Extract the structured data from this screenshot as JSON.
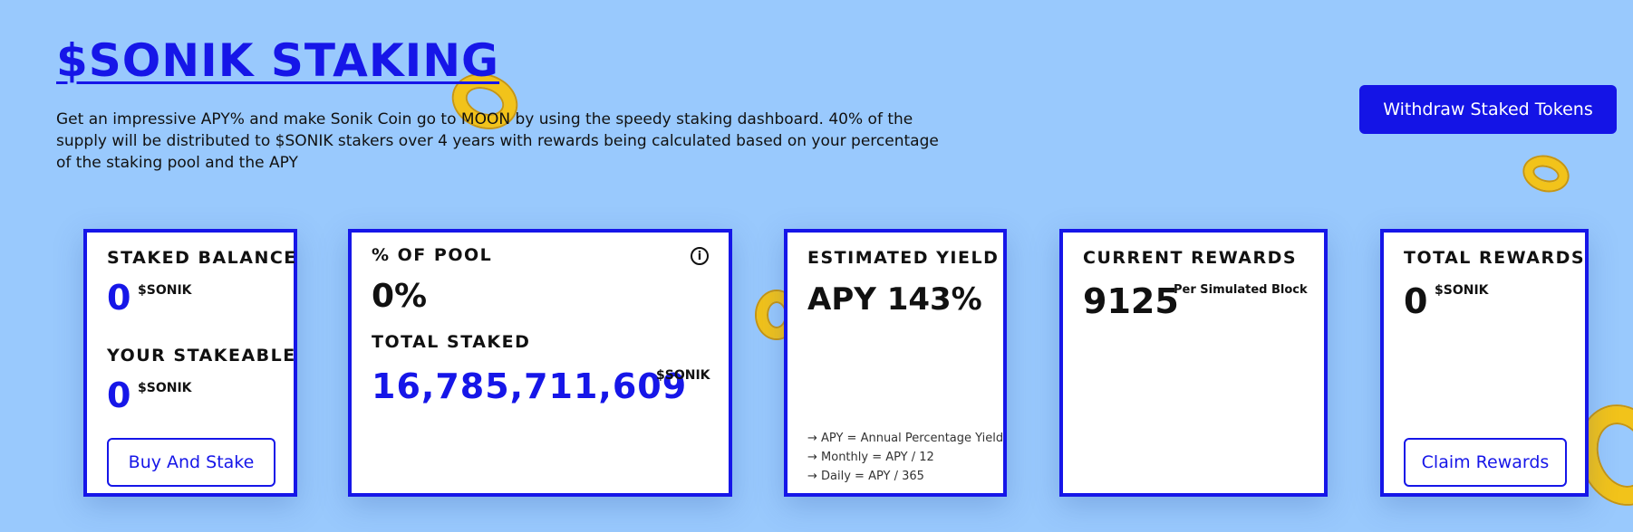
{
  "header": {
    "title": "$SONIK STAKING",
    "description": "Get an impressive APY% and make Sonik Coin go to MOON by using the speedy staking dashboard. 40% of the supply will be distributed to $SONIK stakers over 4 years with rewards being calculated based on your percentage of the staking pool and the APY",
    "withdraw_label": "Withdraw Staked Tokens"
  },
  "cards": {
    "balance": {
      "staked_label": "STAKED BALANCE",
      "staked_value": "0",
      "staked_unit": "$SONIK",
      "stakeable_label": "YOUR STAKEABLE",
      "stakeable_value": "0",
      "stakeable_unit": "$SONIK",
      "button_label": "Buy And Stake"
    },
    "pool": {
      "pool_label": "% OF POOL",
      "pool_value": "0%",
      "total_label": "TOTAL STAKED",
      "total_value": "16,785,711,609",
      "total_unit": "$SONIK",
      "info_icon": "info-icon",
      "info_glyph": "i"
    },
    "yield": {
      "label": "ESTIMATED YIELD",
      "value": "APY 143%",
      "notes": [
        "→ APY = Annual Percentage Yield",
        "→ Monthly = APY / 12",
        "→ Daily = APY / 365"
      ]
    },
    "current_rewards": {
      "label": "CURRENT REWARDS",
      "value": "9125",
      "unit": "Per Simulated Block"
    },
    "total_rewards": {
      "label": "TOTAL REWARDS",
      "value": "0",
      "unit": "$SONIK",
      "button_label": "Claim Rewards"
    }
  },
  "colors": {
    "background": "#99c9fd",
    "accent": "#1616e8",
    "coin": "#f2c31a"
  }
}
